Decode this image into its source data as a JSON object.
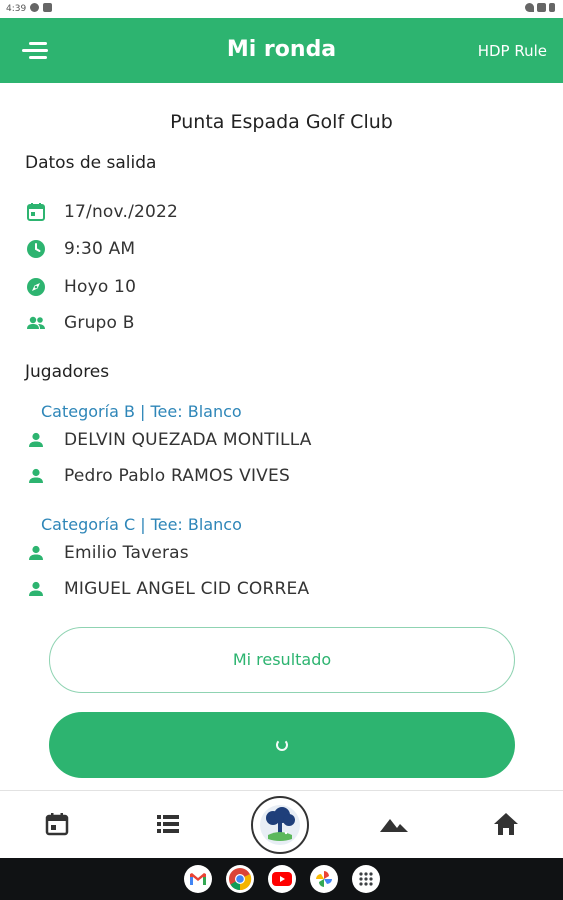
{
  "status_bar": {
    "time": "4:39"
  },
  "app_bar": {
    "title": "Mi ronda",
    "hdp_rule": "HDP Rule",
    "colors": {
      "primary": "#2db470",
      "link": "#2e86b8"
    }
  },
  "club_name": "Punta Espada Golf Club",
  "departure": {
    "title": "Datos de salida",
    "items": [
      {
        "icon": "calendar-icon",
        "text": "17/nov./2022"
      },
      {
        "icon": "clock-icon",
        "text": "9:30 AM"
      },
      {
        "icon": "compass-icon",
        "text": "Hoyo 10"
      },
      {
        "icon": "group-icon",
        "text": "Grupo B"
      }
    ]
  },
  "players": {
    "title": "Jugadores",
    "groups": [
      {
        "category": "Categoría B | Tee: Blanco",
        "players": [
          "DELVIN QUEZADA MONTILLA",
          "Pedro Pablo RAMOS VIVES"
        ]
      },
      {
        "category": "Categoría C | Tee: Blanco",
        "players": [
          "Emilio Taveras",
          "MIGUEL ANGEL CID CORREA"
        ]
      }
    ]
  },
  "actions": {
    "result_button": "Mi resultado"
  },
  "bottom_nav": [
    "calendar-icon",
    "list-icon",
    "club-logo",
    "mountain-icon",
    "home-icon"
  ],
  "dock_apps": [
    "gmail-icon",
    "chrome-icon",
    "youtube-icon",
    "photos-icon",
    "app-drawer-icon"
  ]
}
